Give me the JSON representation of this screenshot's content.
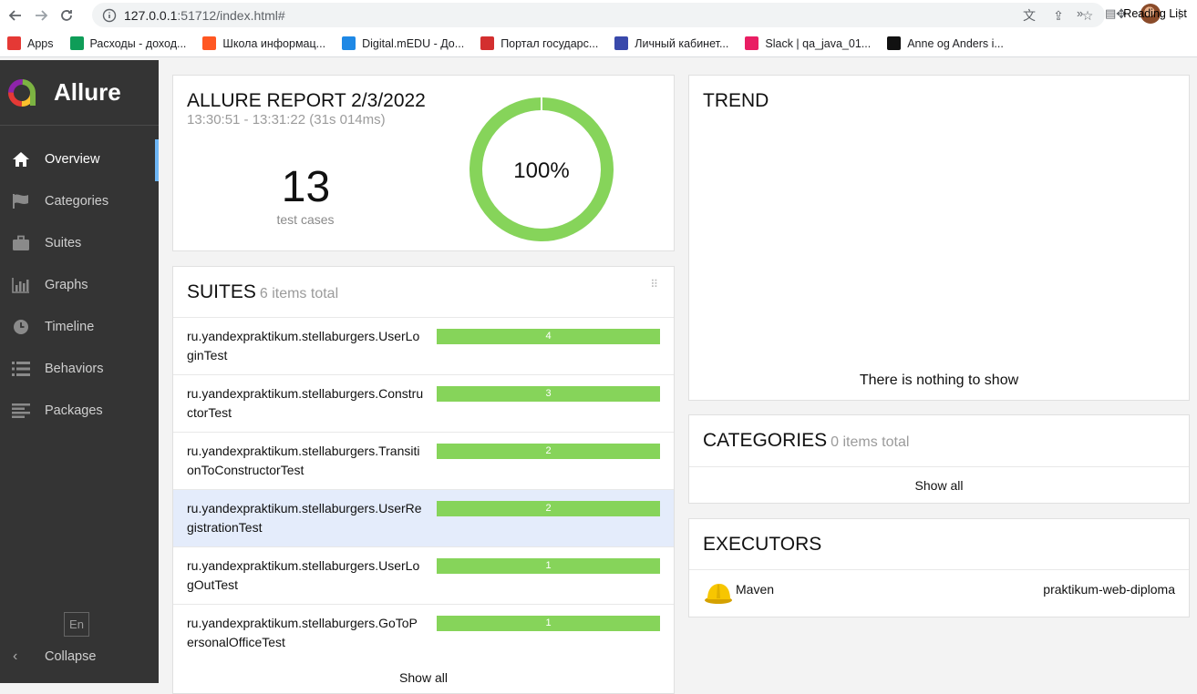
{
  "browser": {
    "url_host": "127.0.0.1",
    "url_rest": ":51712/index.html#",
    "bookmarks": [
      {
        "label": "Apps",
        "color": "#e53935"
      },
      {
        "label": "Расходы - доход...",
        "color": "#0f9d58"
      },
      {
        "label": "Школа информац...",
        "color": "#ff5722"
      },
      {
        "label": "Digital.mEDU - До...",
        "color": "#1e88e5"
      },
      {
        "label": "Портал государс...",
        "color": "#d32f2f"
      },
      {
        "label": "Личный кабинет...",
        "color": "#3949ab"
      },
      {
        "label": "Slack | qa_java_01...",
        "color": "#e91e63"
      },
      {
        "label": "Anne og Anders i...",
        "color": "#111111"
      }
    ],
    "more_label": "»",
    "reading_list": "Reading List"
  },
  "sidebar": {
    "brand": "Allure",
    "items": [
      {
        "label": "Overview",
        "icon": "home-icon"
      },
      {
        "label": "Categories",
        "icon": "flag-icon"
      },
      {
        "label": "Suites",
        "icon": "briefcase-icon"
      },
      {
        "label": "Graphs",
        "icon": "bar-chart-icon"
      },
      {
        "label": "Timeline",
        "icon": "clock-icon"
      },
      {
        "label": "Behaviors",
        "icon": "list-icon"
      },
      {
        "label": "Packages",
        "icon": "align-left-icon"
      }
    ],
    "language": "En",
    "collapse": "Collapse"
  },
  "summary": {
    "title": "ALLURE REPORT 2/3/2022",
    "time": "13:30:51 - 13:31:22 (31s 014ms)",
    "count": "13",
    "count_label": "test cases",
    "percent": "100%",
    "passed_fraction": 1.0,
    "accent": "#86d45a"
  },
  "suites": {
    "title": "SUITES",
    "count_label": "6 items total",
    "rows": [
      {
        "name": "ru.yandexpraktikum.stellaburgers.UserLoginTest",
        "count": "4",
        "highlighted": false
      },
      {
        "name": "ru.yandexpraktikum.stellaburgers.ConstructorTest",
        "count": "3",
        "highlighted": false
      },
      {
        "name": "ru.yandexpraktikum.stellaburgers.TransitionToConstructorTest",
        "count": "2",
        "highlighted": false
      },
      {
        "name": "ru.yandexpraktikum.stellaburgers.UserRegistrationTest",
        "count": "2",
        "highlighted": true
      },
      {
        "name": "ru.yandexpraktikum.stellaburgers.UserLogOutTest",
        "count": "1",
        "highlighted": false
      },
      {
        "name": "ru.yandexpraktikum.stellaburgers.GoToPersonalOfficeTest",
        "count": "1",
        "highlighted": false
      }
    ],
    "show_all": "Show all"
  },
  "trend": {
    "title": "TREND",
    "empty": "There is nothing to show"
  },
  "categories": {
    "title": "CATEGORIES",
    "count_label": "0 items total",
    "show_all": "Show all"
  },
  "executors": {
    "title": "EXECUTORS",
    "name": "Maven",
    "build": "praktikum-web-diploma"
  }
}
